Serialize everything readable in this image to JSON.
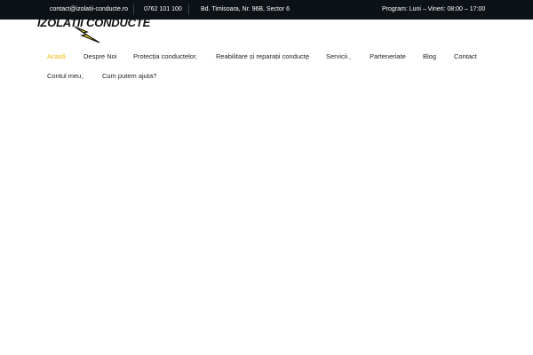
{
  "topbar": {
    "email": "contact@izolatii-conducte.ro",
    "phone": "0762 101 100",
    "address": "Bd. Timisoara, Nr. 96B, Sector 6",
    "hours": "Program: Luni – Vineri: 08:00 – 17:00"
  },
  "logo": {
    "text": "IZOLATII CONDUCTE"
  },
  "nav": {
    "items": [
      {
        "label": "Acasă",
        "active": true
      },
      {
        "label": "Despre Noi"
      },
      {
        "label": "Protecția conductelor",
        "has_submenu": true
      },
      {
        "label": "Reabilitare și reparații conducte",
        "has_submenu": true
      },
      {
        "label": "Servicii",
        "has_submenu": true
      },
      {
        "label": "Parteneriate"
      },
      {
        "label": "Blog"
      },
      {
        "label": "Contact"
      },
      {
        "label": "Contul meu",
        "has_submenu": true
      },
      {
        "label": "Cum putem ajuta?"
      }
    ],
    "caret": "⌄"
  },
  "colors": {
    "topbar_bg": "#0d1217",
    "accent": "#f2b705",
    "text": "#222222"
  }
}
